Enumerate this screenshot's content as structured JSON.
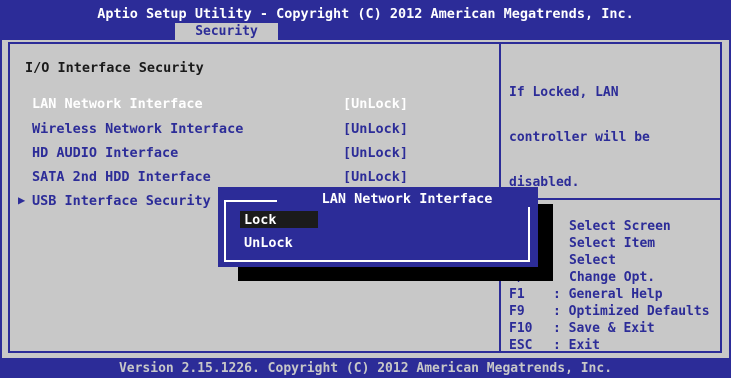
{
  "header": {
    "title": "Aptio Setup Utility - Copyright (C) 2012 American Megatrends, Inc.",
    "active_tab": "Security"
  },
  "section_title": "I/O Interface Security",
  "settings": [
    {
      "label": "LAN Network Interface",
      "value": "[UnLock]"
    },
    {
      "label": "Wireless Network Interface",
      "value": "[UnLock]"
    },
    {
      "label": "HD AUDIO Interface",
      "value": "[UnLock]"
    },
    {
      "label": "SATA 2nd HDD Interface",
      "value": "[UnLock]"
    },
    {
      "label": "USB Interface Security",
      "value": ""
    }
  ],
  "submenu_arrow": "▶",
  "help_text": {
    "line1": "If Locked, LAN",
    "line2": "controller will be",
    "line3": "disabled."
  },
  "key_legend": [
    {
      "key": "",
      "desc": "Select Screen"
    },
    {
      "key": "",
      "desc": "Select Item"
    },
    {
      "key": "",
      "desc": "Select"
    },
    {
      "key": "+/-",
      "desc": "Change Opt."
    },
    {
      "key": "F1",
      "desc": ": General Help"
    },
    {
      "key": "F9",
      "desc": ": Optimized Defaults"
    },
    {
      "key": "F10",
      "desc": ": Save & Exit"
    },
    {
      "key": "ESC",
      "desc": ": Exit"
    }
  ],
  "popup": {
    "title": "LAN Network Interface",
    "options": [
      "Lock",
      "UnLock"
    ],
    "selected": "Lock"
  },
  "footer": "Version 2.15.1226. Copyright (C) 2012 American Megatrends, Inc.",
  "colors": {
    "bios_blue": "#2c2c98",
    "bios_grey": "#c8c8c8"
  }
}
